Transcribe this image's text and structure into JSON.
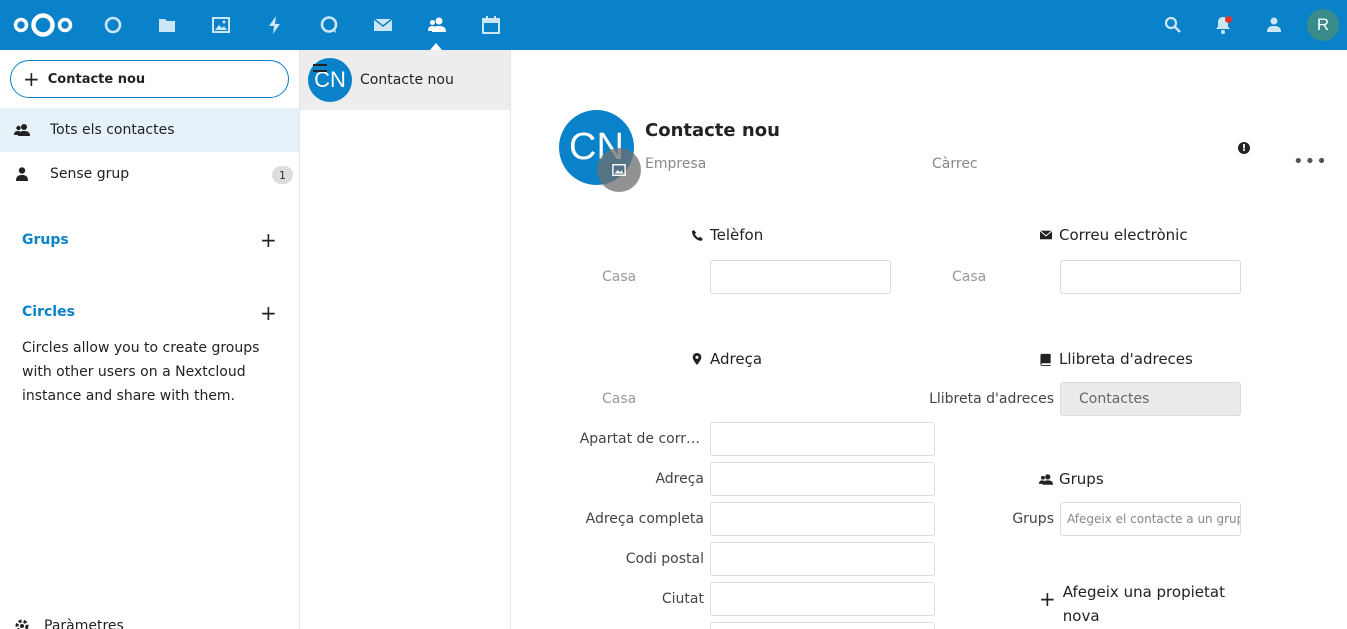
{
  "header": {
    "nav": [
      {
        "name": "dashboard-icon"
      },
      {
        "name": "files-icon"
      },
      {
        "name": "photos-icon"
      },
      {
        "name": "activity-icon"
      },
      {
        "name": "talk-icon"
      },
      {
        "name": "mail-icon"
      },
      {
        "name": "contacts-icon",
        "active": true
      },
      {
        "name": "calendar-icon"
      }
    ],
    "user_initial": "R",
    "accent": "#0a82c9"
  },
  "sidebar": {
    "new_contact": "Contacte nou",
    "all_contacts": "Tots els contactes",
    "no_group": "Sense grup",
    "no_group_count": "1",
    "groups_title": "Grups",
    "circles_title": "Circles",
    "circles_desc": "Circles allow you to create groups with other users on a Nextcloud instance and share with them.",
    "settings": "Paràmetres"
  },
  "list": {
    "item_initials": "CN",
    "item_name": "Contacte nou"
  },
  "details": {
    "initials": "CN",
    "name": "Contacte nou",
    "company_placeholder": "Empresa",
    "title_placeholder": "Càrrec",
    "phone": {
      "title": "Telèfon",
      "type": "Casa",
      "value": ""
    },
    "email": {
      "title": "Correu electrònic",
      "type": "Casa",
      "value": ""
    },
    "address": {
      "title": "Adreça",
      "type": "Casa",
      "fields": [
        {
          "label": "Apartat de corr…",
          "value": ""
        },
        {
          "label": "Adreça",
          "value": ""
        },
        {
          "label": "Adreça completa",
          "value": ""
        },
        {
          "label": "Codi postal",
          "value": ""
        },
        {
          "label": "Ciutat",
          "value": ""
        }
      ]
    },
    "addressbook": {
      "title": "Llibreta d'adreces",
      "label": "Llibreta d'adreces",
      "value": "Contactes"
    },
    "groups": {
      "title": "Grups",
      "label": "Grups",
      "placeholder": "Afegeix el contacte a un grup"
    },
    "add_property": "Afegeix una propietat nova"
  }
}
